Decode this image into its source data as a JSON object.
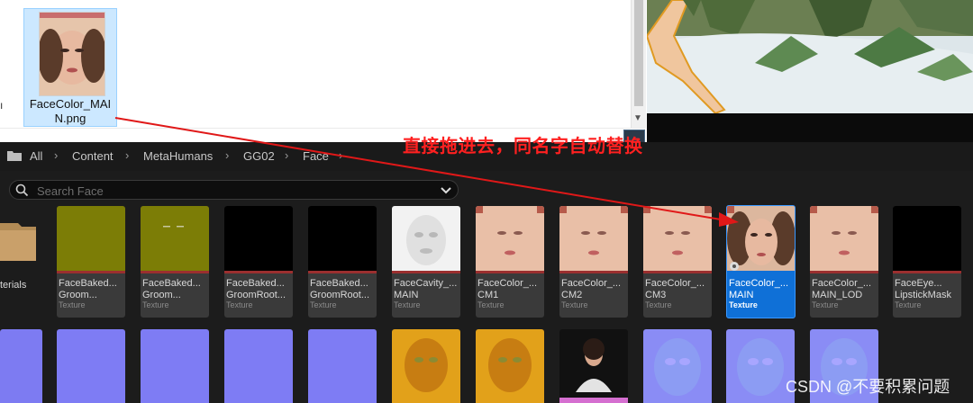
{
  "explorer": {
    "file_name_line1": "FaceColor_MAI",
    "file_name_line2": "N.png",
    "top_text": "..."
  },
  "breadcrumb": [
    "All",
    "Content",
    "MetaHumans",
    "GG02",
    "Face"
  ],
  "search": {
    "placeholder": "Search Face"
  },
  "folder": {
    "label": "terials"
  },
  "assets": [
    {
      "line1": "FaceBaked...",
      "line2": "Groom...",
      "type": "Texture"
    },
    {
      "line1": "FaceBaked...",
      "line2": "Groom...",
      "type": "Texture"
    },
    {
      "line1": "FaceBaked...",
      "line2": "GroomRoot...",
      "type": "Texture"
    },
    {
      "line1": "FaceBaked...",
      "line2": "GroomRoot...",
      "type": "Texture"
    },
    {
      "line1": "FaceCavity_...",
      "line2": "MAIN",
      "type": "Texture"
    },
    {
      "line1": "FaceColor_...",
      "line2": "CM1",
      "type": "Texture"
    },
    {
      "line1": "FaceColor_...",
      "line2": "CM2",
      "type": "Texture"
    },
    {
      "line1": "FaceColor_...",
      "line2": "CM3",
      "type": "Texture"
    },
    {
      "line1": "FaceColor_...",
      "line2": "MAIN",
      "type": "Texture"
    },
    {
      "line1": "FaceColor_...",
      "line2": "MAIN_LOD",
      "type": "Texture"
    },
    {
      "line1": "FaceEye...",
      "line2": "LipstickMask",
      "type": "Texture"
    }
  ],
  "annotation": "直接拖进去，同名字自动替换",
  "watermark": "CSDN @不要积累问题",
  "colors": {
    "selected": "#0f70d7",
    "annotation_red": "#ff2020",
    "normal_map": "#7f7fff",
    "tile_bar": "#9b2f2f"
  }
}
